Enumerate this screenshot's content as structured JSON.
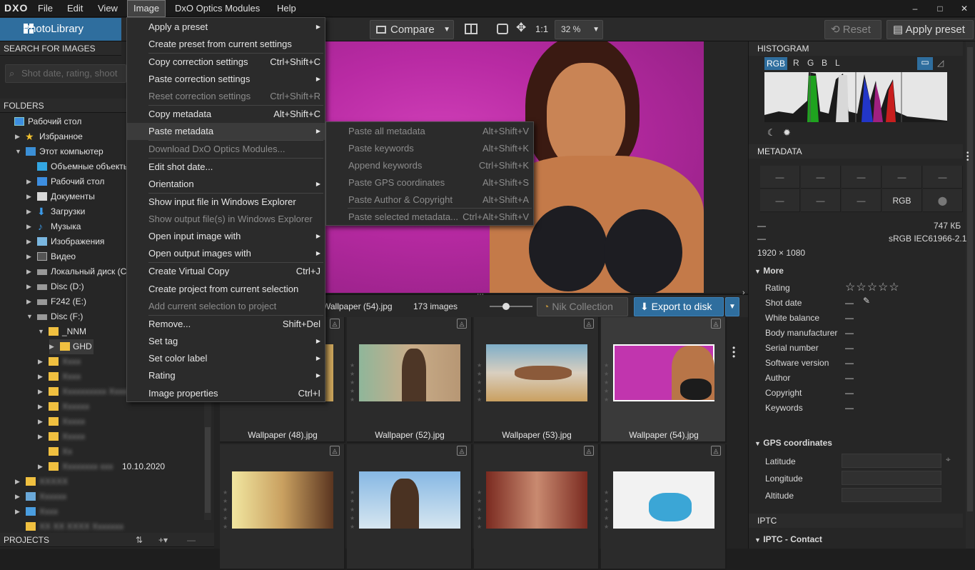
{
  "app": {
    "logo": "DXO"
  },
  "menubar": [
    "File",
    "Edit",
    "View",
    "Image",
    "DxO Optics Modules",
    "Help"
  ],
  "window": {
    "min": "–",
    "max": "□",
    "close": "✕"
  },
  "toolbar": {
    "photolibrary": "PhotoLibrary",
    "compare": "Compare",
    "one_to_one": "1:1",
    "zoom": "32 %",
    "reset": "Reset",
    "apply_preset": "Apply preset"
  },
  "left": {
    "search_title": "SEARCH FOR IMAGES",
    "search_placeholder": "Shot date, rating, shoot",
    "folders_title": "FOLDERS",
    "tree": [
      {
        "label": "Рабочий стол"
      },
      {
        "label": "Избранное"
      },
      {
        "label": "Этот компьютер"
      },
      {
        "label": "Объемные объекты"
      },
      {
        "label": "Рабочий стол"
      },
      {
        "label": "Документы"
      },
      {
        "label": "Загрузки"
      },
      {
        "label": "Музыка"
      },
      {
        "label": "Изображения"
      },
      {
        "label": "Видео"
      },
      {
        "label": "Локальный диск (C:)"
      },
      {
        "label": "Disc (D:)"
      },
      {
        "label": "F242 (E:)"
      },
      {
        "label": "Disc (F:)"
      },
      {
        "label": "_NNM"
      },
      {
        "label": "GHD"
      },
      {
        "label": "10.10.2020"
      }
    ],
    "projects_title": "PROJECTS"
  },
  "filmstrip": {
    "current": "Wallpaper (54).jpg",
    "count": "173 images",
    "nik": "Nik Collection",
    "export": "Export to disk"
  },
  "thumbs": [
    {
      "name": "Wallpaper (48).jpg"
    },
    {
      "name": "Wallpaper (52).jpg"
    },
    {
      "name": "Wallpaper (53).jpg"
    },
    {
      "name": "Wallpaper (54).jpg"
    }
  ],
  "image_menu": [
    {
      "label": "Apply a preset",
      "sc": "",
      "sub": true,
      "dis": false
    },
    {
      "label": "Create preset from current settings",
      "sc": "",
      "sub": false,
      "dis": false
    },
    {
      "label": "Copy correction settings",
      "sc": "Ctrl+Shift+C",
      "sub": false,
      "dis": false
    },
    {
      "label": "Paste correction settings",
      "sc": "",
      "sub": true,
      "dis": false
    },
    {
      "label": "Reset correction settings",
      "sc": "Ctrl+Shift+R",
      "sub": false,
      "dis": true
    },
    {
      "label": "Copy metadata",
      "sc": "Alt+Shift+C",
      "sub": false,
      "dis": false
    },
    {
      "label": "Paste metadata",
      "sc": "",
      "sub": true,
      "dis": false
    },
    {
      "label": "Download DxO Optics Modules...",
      "sc": "",
      "sub": false,
      "dis": true
    },
    {
      "label": "Edit shot date...",
      "sc": "",
      "sub": false,
      "dis": false
    },
    {
      "label": "Orientation",
      "sc": "",
      "sub": true,
      "dis": false
    },
    {
      "label": "Show input file in Windows Explorer",
      "sc": "",
      "sub": false,
      "dis": false
    },
    {
      "label": "Show output file(s) in Windows Explorer",
      "sc": "",
      "sub": false,
      "dis": true
    },
    {
      "label": "Open input image with",
      "sc": "",
      "sub": true,
      "dis": false
    },
    {
      "label": "Open output images with",
      "sc": "",
      "sub": true,
      "dis": false
    },
    {
      "label": "Create Virtual Copy",
      "sc": "Ctrl+J",
      "sub": false,
      "dis": false
    },
    {
      "label": "Create project from current selection",
      "sc": "",
      "sub": false,
      "dis": false
    },
    {
      "label": "Add current selection to project",
      "sc": "",
      "sub": false,
      "dis": true
    },
    {
      "label": "Remove...",
      "sc": "Shift+Del",
      "sub": false,
      "dis": false
    },
    {
      "label": "Set tag",
      "sc": "",
      "sub": true,
      "dis": false
    },
    {
      "label": "Set color label",
      "sc": "",
      "sub": true,
      "dis": false
    },
    {
      "label": "Rating",
      "sc": "",
      "sub": true,
      "dis": false
    },
    {
      "label": "Image properties",
      "sc": "Ctrl+I",
      "sub": false,
      "dis": false
    }
  ],
  "paste_menu": [
    {
      "label": "Paste all metadata",
      "sc": "Alt+Shift+V"
    },
    {
      "label": "Paste keywords",
      "sc": "Alt+Shift+K"
    },
    {
      "label": "Append keywords",
      "sc": "Ctrl+Shift+K"
    },
    {
      "label": "Paste GPS coordinates",
      "sc": "Alt+Shift+S"
    },
    {
      "label": "Paste Author & Copyright",
      "sc": "Alt+Shift+A"
    },
    {
      "label": "Paste selected metadata...",
      "sc": "Ctrl+Alt+Shift+V"
    }
  ],
  "right": {
    "histogram_title": "HISTOGRAM",
    "channels": [
      "RGB",
      "R",
      "G",
      "B",
      "L"
    ],
    "metadata_title": "METADATA",
    "dash": "—",
    "rgb": "RGB",
    "filesize": "747 КБ",
    "colorspace": "sRGB IEC61966-2.1",
    "dims": "1920 × 1080",
    "more_title": "More",
    "fields": [
      "Rating",
      "Shot date",
      "White balance",
      "Body manufacturer",
      "Serial number",
      "Software version",
      "Author",
      "Copyright",
      "Keywords"
    ],
    "gps_title": "GPS coordinates",
    "gps_fields": [
      "Latitude",
      "Longitude",
      "Altitude"
    ],
    "iptc_title": "IPTC",
    "iptc_contact": "IPTC - Contact"
  }
}
